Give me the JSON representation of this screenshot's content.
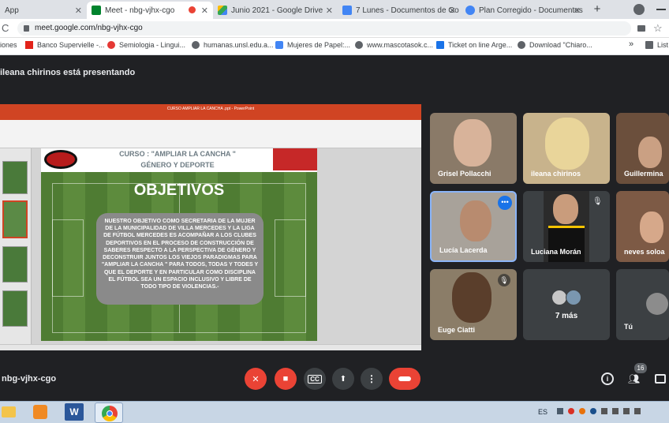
{
  "browser": {
    "tabs": [
      {
        "label": "App",
        "active": false,
        "icon": "app-icon"
      },
      {
        "label": "Meet - nbg-vjhx-cgo",
        "active": true,
        "icon": "meet-icon"
      },
      {
        "label": "Junio 2021 - Google Drive",
        "active": false,
        "icon": "drive-icon"
      },
      {
        "label": "7 Lunes - Documentos de Go",
        "active": false,
        "icon": "docs-icon"
      },
      {
        "label": "Plan Corregido - Documentos",
        "active": false,
        "icon": "docs-icon"
      }
    ],
    "new_tab_label": "+",
    "url": "meet.google.com/nbg-vjhx-cgo"
  },
  "bookmarks": [
    {
      "label": "iones"
    },
    {
      "label": "Banco Supervielle -..."
    },
    {
      "label": "Semiologia - Lingui..."
    },
    {
      "label": "humanas.unsl.edu.a..."
    },
    {
      "label": "Mujeres de Papel:..."
    },
    {
      "label": "www.mascotasok.c..."
    },
    {
      "label": "Ticket on line Arge..."
    },
    {
      "label": "Download \"Chiaro..."
    },
    {
      "label": "»"
    },
    {
      "label": "List"
    }
  ],
  "meet": {
    "presenter_text": "ileana chirinos está presentando",
    "meeting_code": "nbg-vjhx-cgo",
    "participant_count": "16",
    "slide": {
      "app_title": "CURSO AMPLIAR LA CANCHA .ppt - PowerPoint",
      "header": "CURSO : \"AMPLIAR LA CANCHA \"",
      "subheader": "GÉNERO Y  DEPORTE",
      "title": "OBJETIVOS",
      "body": "NUESTRO OBJETIVO COMO SECRETARIA DE LA MUJER DE LA MUNICIPALIDAD DE VILLA MERCEDES Y LA LIGA DE FÚTBOL MERCEDES ES ACOMPAÑAR A LOS CLUBES DEPORTIVOS EN EL PROCESO DE CONSTRUCCIÓN DE SABERES  RESPECTO A LA PERSPECTIVA DE GÉNERO Y DECONSTRUIR JUNTOS LOS VIEJOS PARADIGMAS PARA \"AMPLIAR LA CANCHA \" PARA TODOS, TODAS Y TODES  Y QUE EL DEPORTE Y EN PARTICULAR COMO DISCIPLINA EL FÚTBOL SEA UN ESPACIO  INCLUSIVO Y LIBRE DE TODO TIPO DE VIOLENCIAS.-"
    },
    "participants": [
      {
        "name": "Grisel Pollacchi"
      },
      {
        "name": "ileana chirinos"
      },
      {
        "name": "Guillermina"
      },
      {
        "name": "Lucía Lacerda"
      },
      {
        "name": "Luciana Morán"
      },
      {
        "name": "neves soloa"
      },
      {
        "name": "Euge Ciatti"
      },
      {
        "name": "7 más"
      },
      {
        "name": "Tú"
      }
    ],
    "controls": {
      "captions_label": "CC"
    }
  },
  "taskbar": {
    "language": "ES"
  },
  "colors": {
    "meet_bg": "#202124",
    "hangup": "#ea4335",
    "ppt_ribbon": "#d04423",
    "highlight": "#8ab4f8"
  }
}
